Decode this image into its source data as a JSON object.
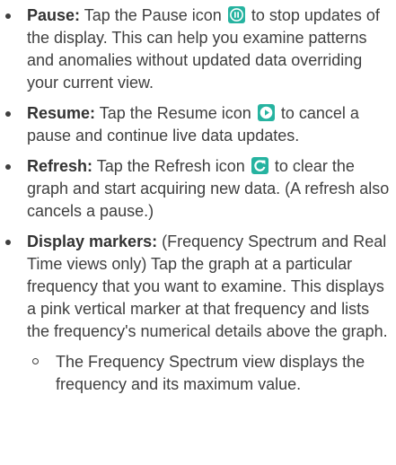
{
  "colors": {
    "text": "#3f3f3f",
    "icon_pause": "#26b3a0",
    "icon_resume": "#26b3a0",
    "icon_refresh": "#26b3a0"
  },
  "items": [
    {
      "term": "Pause:",
      "before_icon": " Tap the Pause icon ",
      "icon": "pause-icon",
      "after_icon": " to stop updates of the display. This can help you examine patterns and anomalies without updated data overriding your current view."
    },
    {
      "term": "Resume:",
      "before_icon": " Tap the Resume icon ",
      "icon": "resume-icon",
      "after_icon": " to cancel a pause and continue live data updates."
    },
    {
      "term": "Refresh:",
      "before_icon": " Tap the Refresh icon ",
      "icon": "refresh-icon",
      "after_icon": " to clear the graph and start acquiring new data. (A refresh also cancels a pause.)"
    },
    {
      "term": "Display markers:",
      "text": " (Frequency Spectrum and Real Time views only) Tap the graph at a particular frequency that you want to examine. This displays a pink vertical marker at that frequency and lists the frequency's numerical details above the graph.",
      "subitems": [
        "The Frequency Spectrum view displays the frequency and its maximum value."
      ]
    }
  ]
}
